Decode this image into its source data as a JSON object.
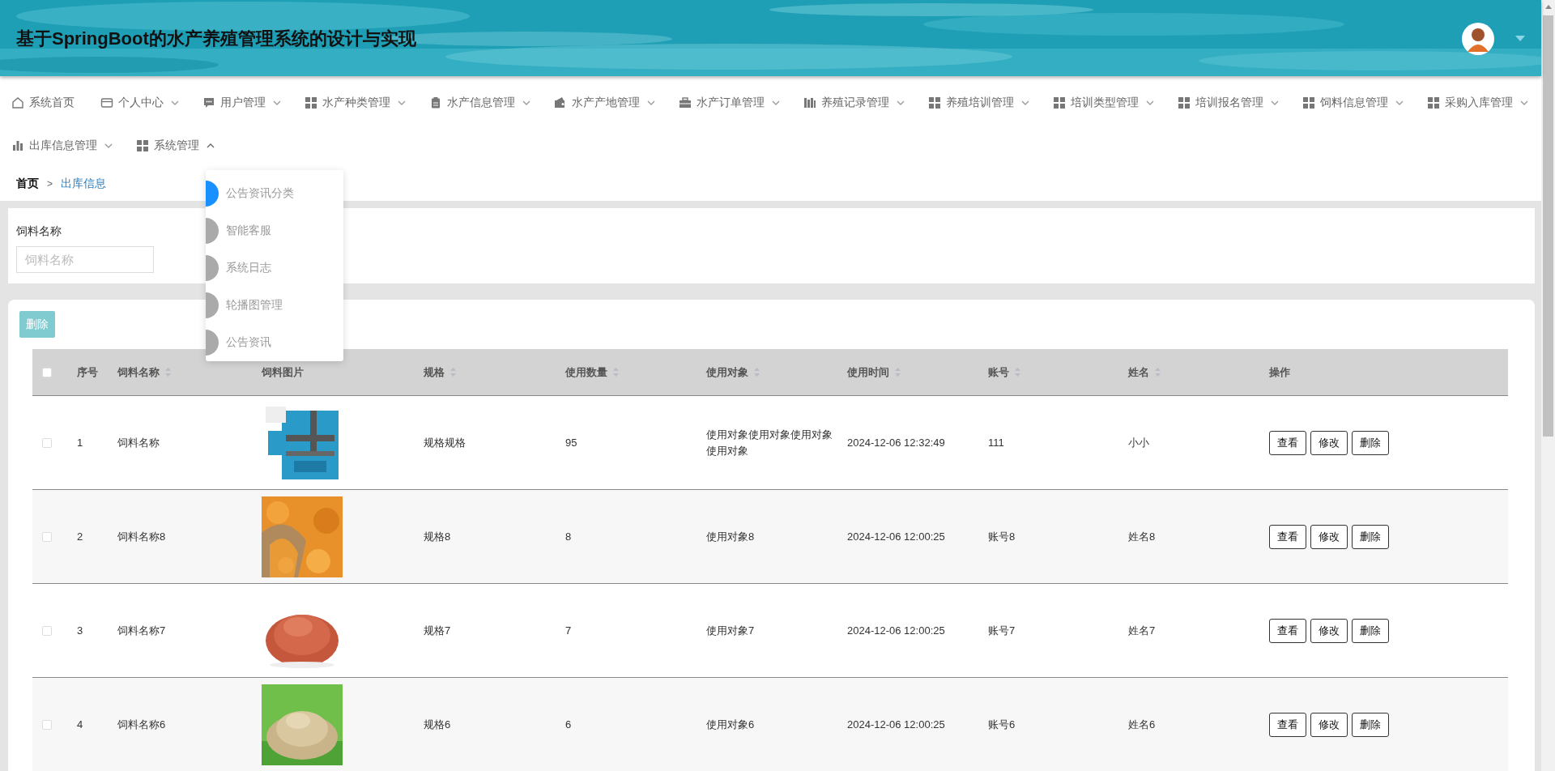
{
  "header": {
    "title": "基于SpringBoot的水产养殖管理系统的设计与实现"
  },
  "nav": [
    {
      "label": "系统首页",
      "kind": "link"
    },
    {
      "label": "个人中心",
      "kind": "menu",
      "expanded": false
    },
    {
      "label": "用户管理",
      "kind": "menu",
      "expanded": false
    },
    {
      "label": "水产种类管理",
      "kind": "menu",
      "expanded": false
    },
    {
      "label": "水产信息管理",
      "kind": "menu",
      "expanded": false
    },
    {
      "label": "水产产地管理",
      "kind": "menu",
      "expanded": false
    },
    {
      "label": "水产订单管理",
      "kind": "menu",
      "expanded": false
    },
    {
      "label": "养殖记录管理",
      "kind": "menu",
      "expanded": false
    },
    {
      "label": "养殖培训管理",
      "kind": "menu",
      "expanded": false
    },
    {
      "label": "培训类型管理",
      "kind": "menu",
      "expanded": false
    },
    {
      "label": "培训报名管理",
      "kind": "menu",
      "expanded": false
    },
    {
      "label": "饲料信息管理",
      "kind": "menu",
      "expanded": false
    },
    {
      "label": "采购入库管理",
      "kind": "menu",
      "expanded": false
    },
    {
      "label": "出库信息管理",
      "kind": "menu",
      "expanded": false
    },
    {
      "label": "系统管理",
      "kind": "menu",
      "expanded": true
    }
  ],
  "submenu": [
    {
      "label": "公告资讯分类",
      "selected": true
    },
    {
      "label": "智能客服",
      "selected": false
    },
    {
      "label": "系统日志",
      "selected": false
    },
    {
      "label": "轮播图管理",
      "selected": false
    },
    {
      "label": "公告资讯",
      "selected": false
    }
  ],
  "breadcrumb": {
    "separator": ">",
    "items": [
      {
        "label": "首页",
        "selected": false
      },
      {
        "label": "出库信息",
        "selected": true
      }
    ]
  },
  "search": {
    "label": "饲料名称",
    "placeholder": "饲料名称"
  },
  "toolbar": {
    "delete_button": "删除"
  },
  "table": {
    "all_checked": false,
    "columns": [
      {
        "label": "序号",
        "sortable": false
      },
      {
        "label": "饲料名称",
        "sortable": true
      },
      {
        "label": "饲料图片",
        "sortable": false
      },
      {
        "label": "规格",
        "sortable": true
      },
      {
        "label": "使用数量",
        "sortable": true
      },
      {
        "label": "使用对象",
        "sortable": true
      },
      {
        "label": "使用时间",
        "sortable": true
      },
      {
        "label": "账号",
        "sortable": true
      },
      {
        "label": "姓名",
        "sortable": true
      },
      {
        "label": "操作",
        "sortable": false
      }
    ],
    "rows": [
      {
        "checked": false,
        "cells": [
          "1",
          "饲料名称",
          {
            "kind": "picture"
          },
          "规格规格",
          "95",
          "使用对象使用对象使用对象使用对象",
          "2024-12-06 12:32:49",
          "111",
          "小小"
        ],
        "actions": [
          "查看",
          "修改",
          "删除"
        ]
      },
      {
        "checked": false,
        "cells": [
          "2",
          "饲料名称8",
          {
            "kind": "picture"
          },
          "规格8",
          "8",
          "使用对象8",
          "2024-12-06 12:00:25",
          "账号8",
          "姓名8"
        ],
        "actions": [
          "查看",
          "修改",
          "删除"
        ]
      },
      {
        "checked": false,
        "cells": [
          "3",
          "饲料名称7",
          {
            "kind": "picture"
          },
          "规格7",
          "7",
          "使用对象7",
          "2024-12-06 12:00:25",
          "账号7",
          "姓名7"
        ],
        "actions": [
          "查看",
          "修改",
          "删除"
        ]
      },
      {
        "checked": false,
        "cells": [
          "4",
          "饲料名称6",
          {
            "kind": "picture"
          },
          "规格6",
          "6",
          "使用对象6",
          "2024-12-06 12:00:25",
          "账号6",
          "姓名6"
        ],
        "actions": [
          "查看",
          "修改",
          "删除"
        ]
      }
    ]
  }
}
